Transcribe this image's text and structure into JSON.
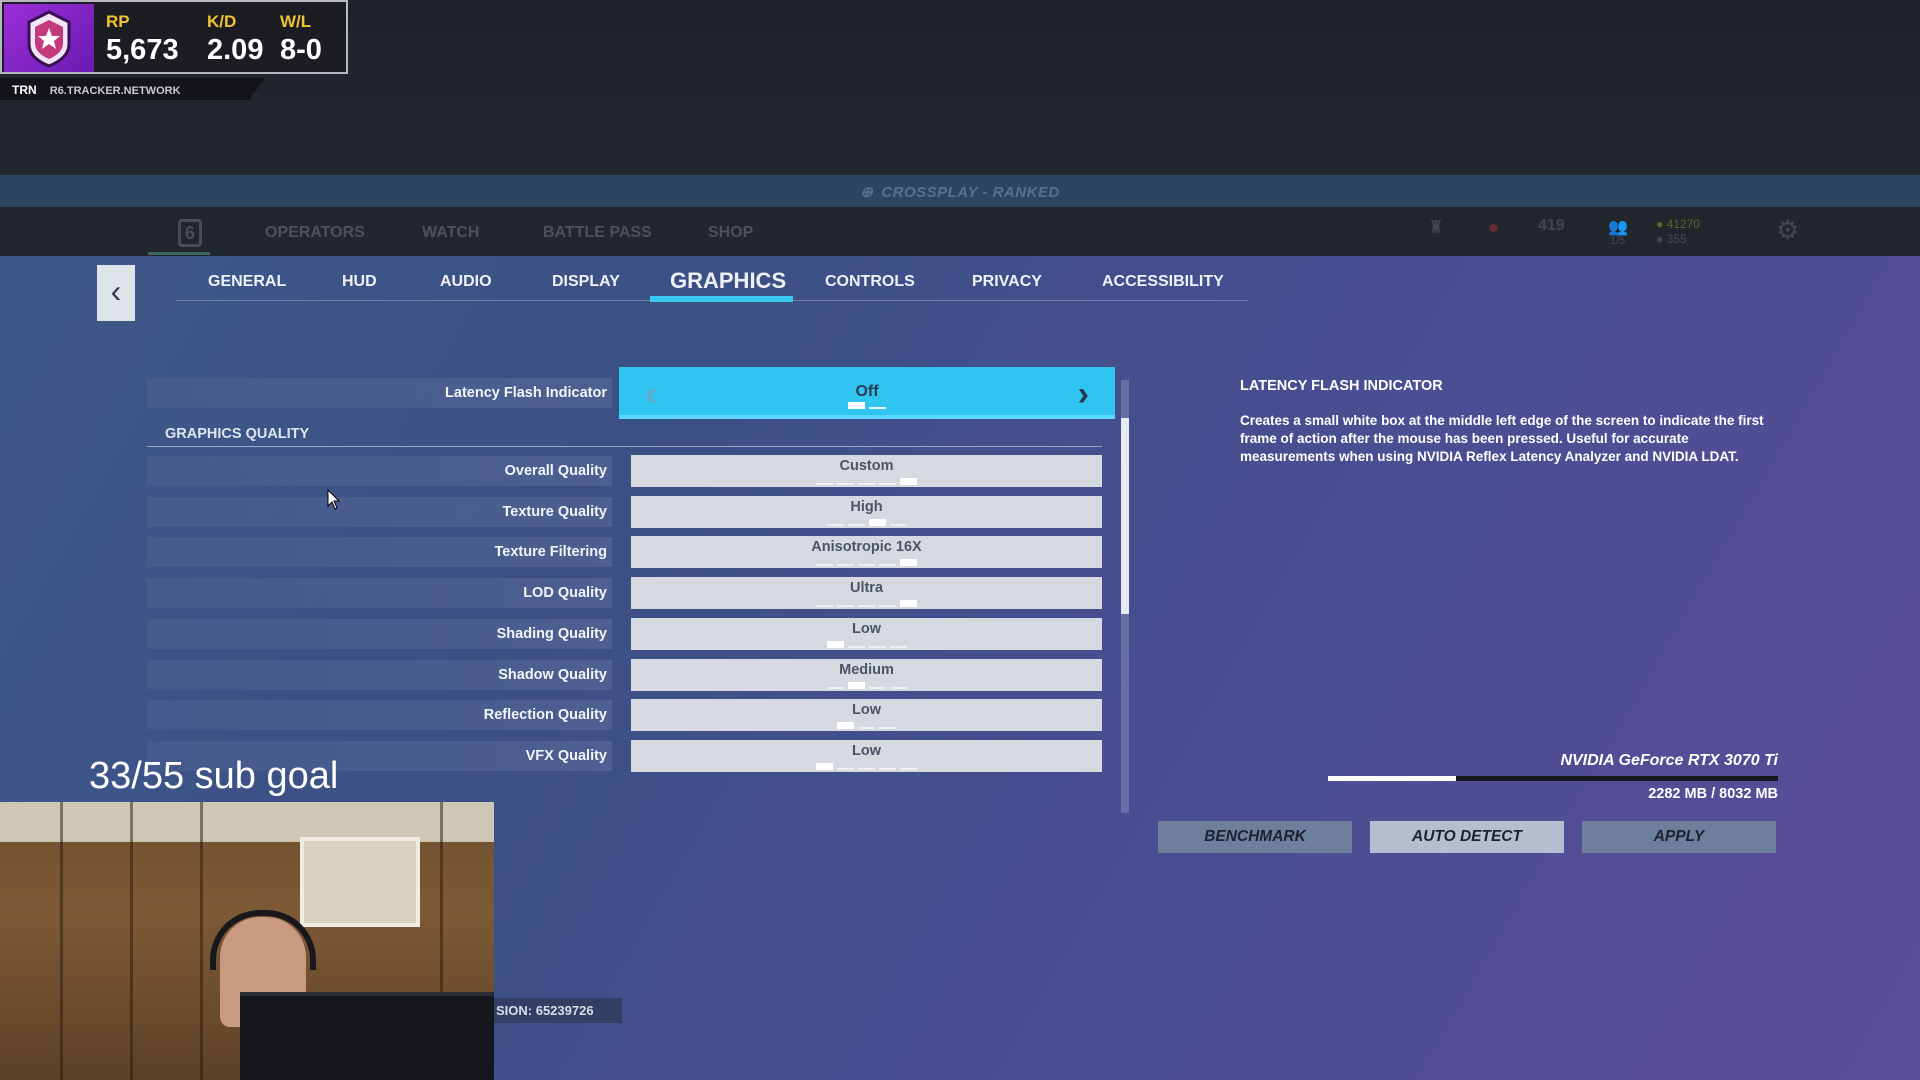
{
  "overlay": {
    "rp_label": "RP",
    "rp_value": "5,673",
    "kd_label": "K/D",
    "kd_value": "2.09",
    "wl_label": "W/L",
    "wl_value": "8-0",
    "trn": "TRN",
    "site": "R6.TRACKER.NETWORK",
    "sub_goal": "33/55 sub goal",
    "version": "SION: 65239726",
    "accent_color": "#f1c232",
    "rank_badge_color": "#9b2fd8"
  },
  "crossplay": "CROSSPLAY - RANKED",
  "main_nav": {
    "items": [
      "OPERATORS",
      "WATCH",
      "BATTLE PASS",
      "SHOP"
    ],
    "level": "419",
    "squad": "1/5",
    "renown": "41270",
    "credits": "355"
  },
  "settings_tabs": {
    "items": [
      "GENERAL",
      "HUD",
      "AUDIO",
      "DISPLAY",
      "GRAPHICS",
      "CONTROLS",
      "PRIVACY",
      "ACCESSIBILITY"
    ],
    "active": "GRAPHICS",
    "active_color": "#39c8f0"
  },
  "latency": {
    "label": "Latency Flash Indicator",
    "value": "Off",
    "options": 2,
    "selected_index": 0
  },
  "section_title": "GRAPHICS QUALITY",
  "rows": [
    {
      "label": "Overall Quality",
      "value": "Custom",
      "options": 5,
      "selected_index": 4
    },
    {
      "label": "Texture Quality",
      "value": "High",
      "options": 4,
      "selected_index": 2
    },
    {
      "label": "Texture Filtering",
      "value": "Anisotropic 16X",
      "options": 5,
      "selected_index": 4
    },
    {
      "label": "LOD Quality",
      "value": "Ultra",
      "options": 5,
      "selected_index": 4
    },
    {
      "label": "Shading Quality",
      "value": "Low",
      "options": 4,
      "selected_index": 0
    },
    {
      "label": "Shadow Quality",
      "value": "Medium",
      "options": 4,
      "selected_index": 1
    },
    {
      "label": "Reflection Quality",
      "value": "Low",
      "options": 3,
      "selected_index": 0
    },
    {
      "label": "VFX Quality",
      "value": "Low",
      "options": 5,
      "selected_index": 0
    }
  ],
  "info": {
    "title": "LATENCY FLASH INDICATOR",
    "description": "Creates a small white box at the middle left edge of the screen to indicate the first frame of action after the mouse has been pressed. Useful for accurate measurements when using NVIDIA Reflex Latency Analyzer and NVIDIA LDAT."
  },
  "gpu": {
    "name": "NVIDIA GeForce RTX 3070 Ti",
    "vram_used_mb": 2282,
    "vram_total_mb": 8032,
    "vram_text": "2282 MB / 8032 MB"
  },
  "actions": {
    "benchmark": "BENCHMARK",
    "auto_detect": "AUTO DETECT",
    "apply": "APPLY"
  }
}
